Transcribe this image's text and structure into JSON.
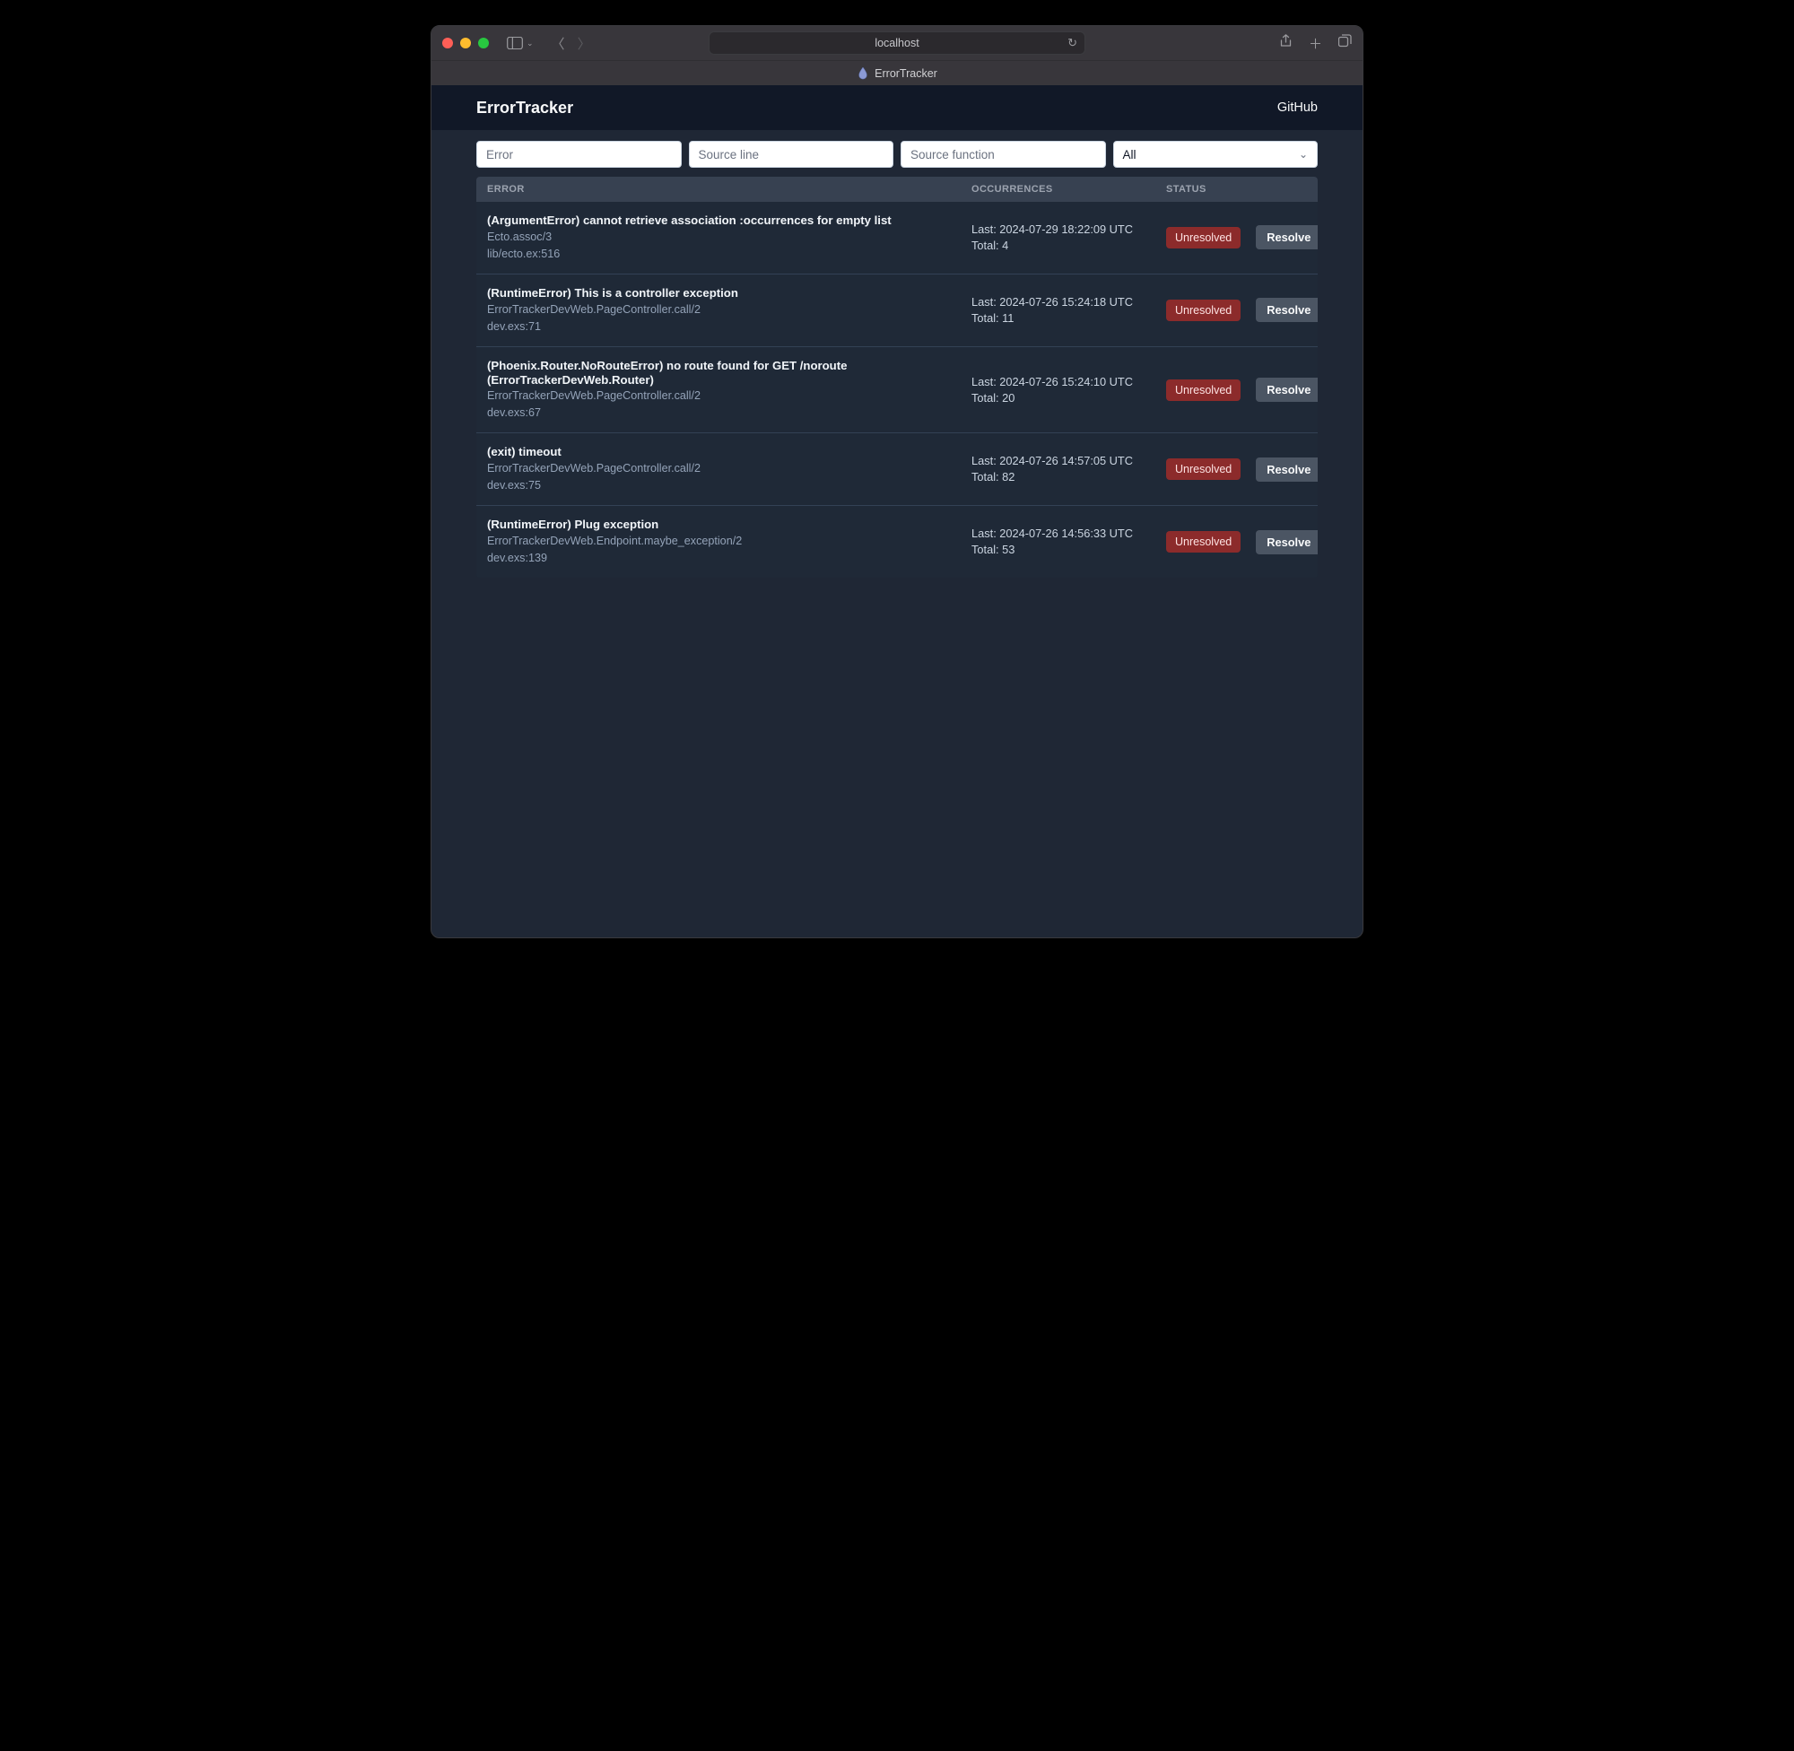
{
  "browser": {
    "address": "localhost",
    "tab_title": "ErrorTracker"
  },
  "header": {
    "title": "ErrorTracker",
    "github": "GitHub"
  },
  "filters": {
    "error_placeholder": "Error",
    "source_line_placeholder": "Source line",
    "source_function_placeholder": "Source function",
    "filter_selected": "All"
  },
  "table": {
    "col_error": "ERROR",
    "col_occurrences": "OCCURRENCES",
    "col_status": "STATUS"
  },
  "labels": {
    "last_prefix": "Last: ",
    "total_prefix": "Total: ",
    "unresolved": "Unresolved",
    "resolve": "Resolve"
  },
  "errors": [
    {
      "title": "(ArgumentError) cannot retrieve association :occurrences for empty list",
      "fn": "Ecto.assoc/3",
      "loc": "lib/ecto.ex:516",
      "last": "2024-07-29 18:22:09 UTC",
      "total": "4"
    },
    {
      "title": "(RuntimeError) This is a controller exception",
      "fn": "ErrorTrackerDevWeb.PageController.call/2",
      "loc": "dev.exs:71",
      "last": "2024-07-26 15:24:18 UTC",
      "total": "11"
    },
    {
      "title": "(Phoenix.Router.NoRouteError) no route found for GET /noroute (ErrorTrackerDevWeb.Router)",
      "fn": "ErrorTrackerDevWeb.PageController.call/2",
      "loc": "dev.exs:67",
      "last": "2024-07-26 15:24:10 UTC",
      "total": "20"
    },
    {
      "title": "(exit) timeout",
      "fn": "ErrorTrackerDevWeb.PageController.call/2",
      "loc": "dev.exs:75",
      "last": "2024-07-26 14:57:05 UTC",
      "total": "82"
    },
    {
      "title": "(RuntimeError) Plug exception",
      "fn": "ErrorTrackerDevWeb.Endpoint.maybe_exception/2",
      "loc": "dev.exs:139",
      "last": "2024-07-26 14:56:33 UTC",
      "total": "53"
    }
  ]
}
